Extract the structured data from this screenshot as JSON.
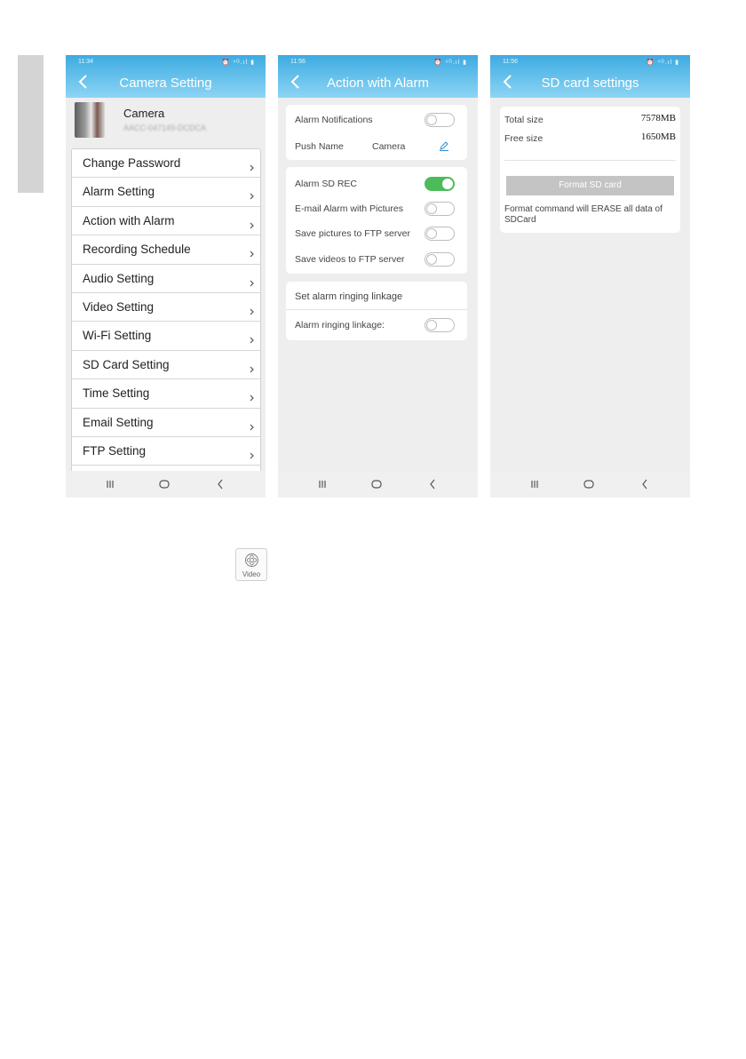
{
  "phone1": {
    "status_time": "11:34",
    "status_icons": "⏰ ⁴ᴳ.ıl ▮",
    "title": "Camera Setting",
    "camera_name": "Camera",
    "camera_id": "AACC-047149-DCDCA",
    "menu": [
      "Change Password",
      "Alarm Setting",
      "Action with Alarm",
      "Recording Schedule",
      "Audio Setting",
      "Video Setting",
      "Wi-Fi Setting",
      "SD Card Setting",
      "Time Setting",
      "Email Setting",
      "FTP Setting"
    ]
  },
  "phone2": {
    "status_time": "11:56",
    "status_icons": "⏰ ⁴ᴳ.ıl ▮",
    "title": "Action with Alarm",
    "alarm_notifications": "Alarm Notifications",
    "alarm_notifications_on": false,
    "push_name_label": "Push Name",
    "push_name_value": "Camera",
    "alarm_sd_rec": "Alarm SD REC",
    "alarm_sd_rec_on": true,
    "email_alarm": "E-mail Alarm with Pictures",
    "email_alarm_on": false,
    "save_pictures_ftp": "Save pictures to FTP server",
    "save_pictures_ftp_on": false,
    "save_videos_ftp": "Save videos to FTP server",
    "save_videos_ftp_on": false,
    "ringing_header": "Set alarm ringing linkage",
    "ringing_label": "Alarm ringing linkage:",
    "ringing_on": false
  },
  "phone3": {
    "status_time": "11:56",
    "status_icons": "⏰ ⁴ᴳ.ıl ▮",
    "title": "SD card settings",
    "total_size_label": "Total size",
    "total_size_value": "7578MB",
    "free_size_label": "Free size",
    "free_size_value": "1650MB",
    "format_button": "Format SD card",
    "format_note": "Format command will ERASE all data of SDCard"
  },
  "video_icon_label": "Video",
  "colors": {
    "header_top": "#3dabe0",
    "header_bottom": "#8dd5f5",
    "toggle_on": "#4cbc5a",
    "format_button": "#c4c4c4"
  }
}
